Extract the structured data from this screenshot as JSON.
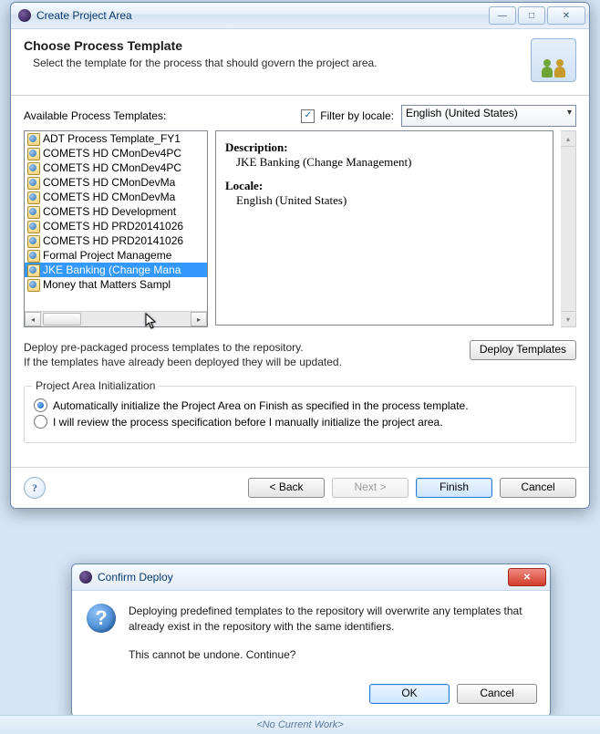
{
  "main_window": {
    "title": "Create Project Area",
    "banner": {
      "title": "Choose Process Template",
      "description": "Select the template for the process that should govern the project area."
    },
    "available_label": "Available Process Templates:",
    "filter_label": "Filter by locale:",
    "filter_checked": true,
    "locale_selected": "English (United States)",
    "templates": [
      "ADT Process Template_FY1",
      "COMETS HD CMonDev4PC",
      "COMETS HD CMonDev4PC",
      "COMETS HD CMonDevMa",
      "COMETS HD CMonDevMa",
      "COMETS HD Development",
      "COMETS HD PRD20141026",
      "COMETS HD PRD20141026",
      "Formal Project Manageme",
      "JKE Banking (Change Mana",
      "Money that Matters Sampl"
    ],
    "selected_index": 9,
    "detail": {
      "description_label": "Description:",
      "description_value": "JKE Banking (Change Management)",
      "locale_label": "Locale:",
      "locale_value": "English (United States)"
    },
    "deploy_text_line1": "Deploy pre-packaged process templates to the repository.",
    "deploy_text_line2": "If the templates have already been deployed they will be updated.",
    "deploy_button": "Deploy Templates",
    "init": {
      "legend": "Project Area Initialization",
      "opt1": "Automatically initialize the Project Area on Finish as specified in the process template.",
      "opt2": "I will review the process specification before I manually initialize the project area.",
      "selected": 0
    },
    "footer": {
      "back": "< Back",
      "next": "Next >",
      "finish": "Finish",
      "cancel": "Cancel"
    }
  },
  "confirm_dialog": {
    "title": "Confirm Deploy",
    "line1": "Deploying predefined templates to the repository will overwrite any templates that already exist in the repository with the same identifiers.",
    "line2": "This cannot be undone. Continue?",
    "ok": "OK",
    "cancel": "Cancel"
  },
  "statusbar": "<No Current Work>"
}
